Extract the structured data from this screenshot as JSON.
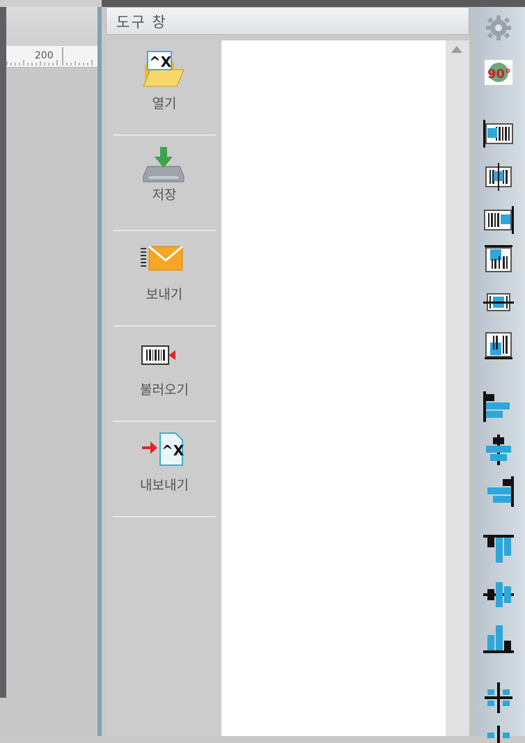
{
  "canvas": {
    "ruler_label": "200"
  },
  "tool_window": {
    "title": "도구 창",
    "items": [
      {
        "label": "열기",
        "icon": "open-folder-icon"
      },
      {
        "label": "저장",
        "icon": "save-disk-icon"
      },
      {
        "label": "보내기",
        "icon": "send-envelope-icon"
      },
      {
        "label": "불러오기",
        "icon": "import-barcode-icon"
      },
      {
        "label": "내보내기",
        "icon": "export-file-icon"
      }
    ]
  },
  "right_toolbar": {
    "buttons": [
      "settings-gear-icon",
      "rotate-90-icon",
      "align-left-barcode-icon",
      "align-center-barcode-icon",
      "align-right-barcode-icon",
      "align-top-barcode-icon",
      "align-middle-barcode-icon",
      "align-bottom-barcode-icon",
      "align-objects-left-icon",
      "align-objects-center-icon",
      "align-objects-right-icon",
      "align-objects-top-icon",
      "align-objects-middle-icon",
      "align-objects-bottom-icon",
      "distribute-icon"
    ],
    "rotate_label": "90°"
  },
  "colors": {
    "accent_blue": "#2ea6d9",
    "arrow_red": "#e0262d",
    "save_green": "#4caf50",
    "folder_yellow": "#f2c94c"
  }
}
